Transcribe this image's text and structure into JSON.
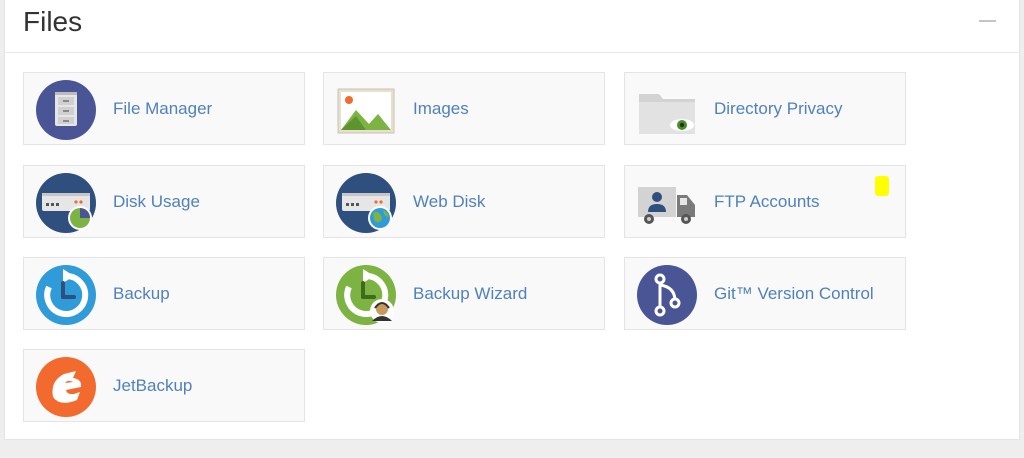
{
  "panel": {
    "title": "Files"
  },
  "tiles": {
    "file_manager": {
      "label": "File Manager",
      "icon": "file-manager-icon"
    },
    "images": {
      "label": "Images",
      "icon": "images-icon"
    },
    "directory_privacy": {
      "label": "Directory Privacy",
      "icon": "directory-privacy-icon"
    },
    "disk_usage": {
      "label": "Disk Usage",
      "icon": "disk-usage-icon"
    },
    "web_disk": {
      "label": "Web Disk",
      "icon": "web-disk-icon"
    },
    "ftp_accounts": {
      "label": "FTP Accounts",
      "icon": "ftp-accounts-icon"
    },
    "backup": {
      "label": "Backup",
      "icon": "backup-icon"
    },
    "backup_wizard": {
      "label": "Backup Wizard",
      "icon": "backup-wizard-icon"
    },
    "git_version_control": {
      "label": "Git™ Version Control",
      "icon": "git-version-control-icon"
    },
    "jetbackup": {
      "label": "JetBackup",
      "icon": "jetbackup-icon"
    }
  },
  "colors": {
    "link_text": "#4f81bd",
    "highlight_marker": "#ffff00",
    "navy": "#4a5596",
    "blue": "#2f9bd8",
    "green": "#7cb342",
    "orange": "#f26a2e"
  }
}
